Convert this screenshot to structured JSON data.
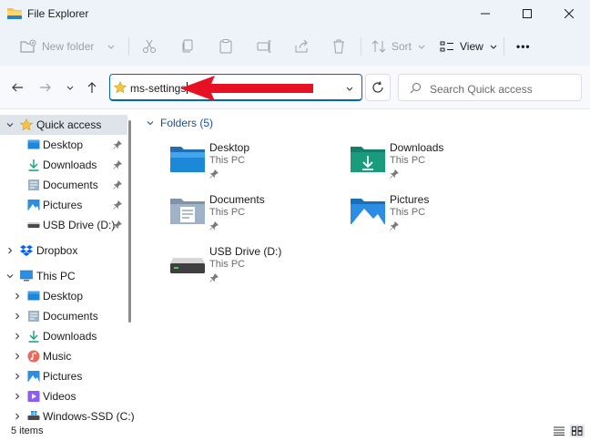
{
  "window": {
    "title": "File Explorer"
  },
  "toolbar": {
    "new_folder": "New folder",
    "sort": "Sort",
    "view": "View",
    "more": "•••"
  },
  "address": {
    "value": "ms-settings"
  },
  "search": {
    "placeholder": "Search Quick access"
  },
  "sidebar": {
    "quick_access": {
      "label": "Quick access",
      "items": [
        {
          "label": "Desktop",
          "icon": "desktop-icon"
        },
        {
          "label": "Downloads",
          "icon": "downloads-icon"
        },
        {
          "label": "Documents",
          "icon": "documents-icon"
        },
        {
          "label": "Pictures",
          "icon": "pictures-icon"
        },
        {
          "label": "USB Drive (D:)",
          "icon": "usb-drive-icon"
        }
      ]
    },
    "dropbox": {
      "label": "Dropbox"
    },
    "this_pc": {
      "label": "This PC",
      "items": [
        {
          "label": "Desktop"
        },
        {
          "label": "Documents"
        },
        {
          "label": "Downloads"
        },
        {
          "label": "Music"
        },
        {
          "label": "Pictures"
        },
        {
          "label": "Videos"
        },
        {
          "label": "Windows-SSD (C:)"
        }
      ]
    }
  },
  "content": {
    "group_title": "Folders (5)",
    "folders": [
      {
        "name": "Desktop",
        "location": "This PC"
      },
      {
        "name": "Downloads",
        "location": "This PC"
      },
      {
        "name": "Documents",
        "location": "This PC"
      },
      {
        "name": "Pictures",
        "location": "This PC"
      },
      {
        "name": "USB Drive (D:)",
        "location": "This PC"
      }
    ]
  },
  "status": {
    "count": "5 items"
  },
  "colors": {
    "accent": "#0067c0",
    "annotation": "#e81123",
    "selection": "#dfe4ea",
    "folder_header": "#1f4e8c"
  }
}
